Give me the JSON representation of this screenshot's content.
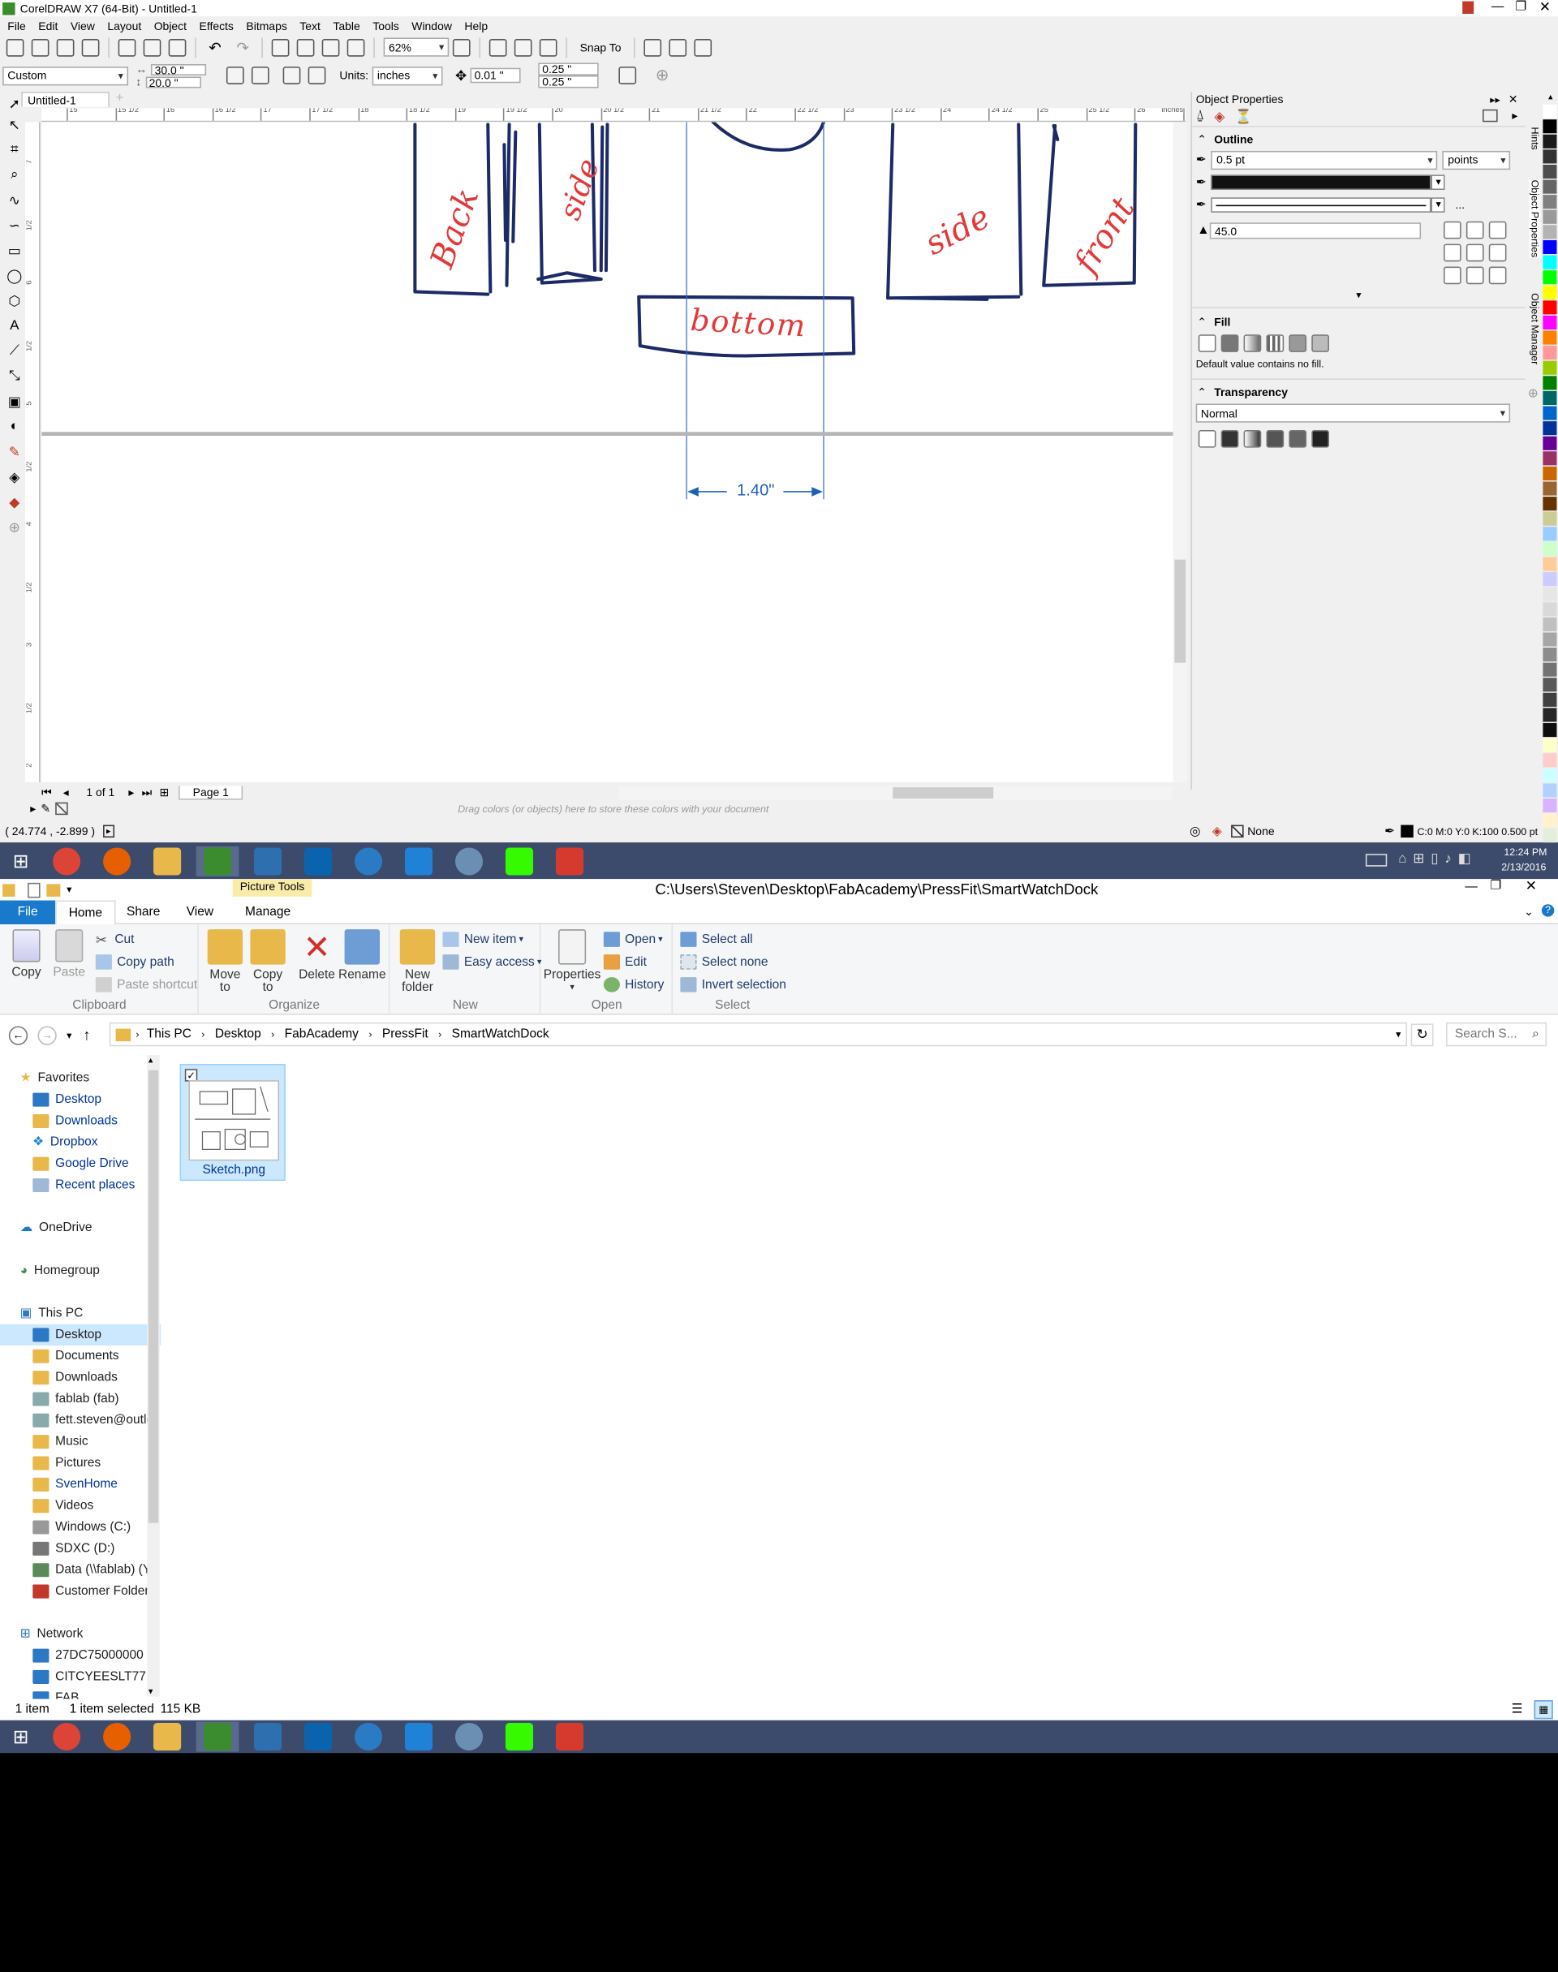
{
  "corel": {
    "title": "CorelDRAW X7 (64-Bit) - Untitled-1",
    "menu": [
      "File",
      "Edit",
      "View",
      "Layout",
      "Object",
      "Effects",
      "Bitmaps",
      "Text",
      "Table",
      "Tools",
      "Window",
      "Help"
    ],
    "zoom": "62%",
    "snap_to": "Snap To",
    "page_size": "Custom",
    "width": "30.0 \"",
    "height": "20.0 \"",
    "units_label": "Units:",
    "units": "inches",
    "nudge": "0.01 \"",
    "dup_x": "0.25 \"",
    "dup_y": "0.25 \"",
    "doc_tab": "Untitled-1",
    "ruler_ticks": [
      "15",
      "15 1/2",
      "16",
      "16 1/2",
      "17",
      "17 1/2",
      "18",
      "18 1/2",
      "19",
      "19 1/2",
      "20",
      "20 1/2",
      "21",
      "21 1/2",
      "22",
      "22 1/2",
      "23",
      "23 1/2",
      "24",
      "24 1/2",
      "25",
      "25 1/2",
      "26",
      "26 1/2"
    ],
    "ruler_unit": "inches",
    "vruler_ticks": [
      "7",
      "1/2",
      "6",
      "1/2",
      "5",
      "1/2",
      "4",
      "1/2",
      "3",
      "1/2",
      "2"
    ],
    "sketch_labels": {
      "back": "Back",
      "side_left": "side",
      "side_right": "side",
      "front": "front",
      "bottom": "bottom"
    },
    "dimension": "1.40\"",
    "page_nav": "1 of 1",
    "page_tab": "Page 1",
    "color_hint": "Drag colors (or objects) here to store these colors with your document",
    "status_coords": "( 24.774 , -2.899 )",
    "status_fill": "None",
    "status_outline": "C:0 M:0 Y:0 K:100  0.500 pt",
    "docker": {
      "title": "Object Properties",
      "outline_head": "Outline",
      "outline_width": "0.5 pt",
      "outline_units": "points",
      "miter": "45.0",
      "more": "...",
      "fill_head": "Fill",
      "fill_note": "Default value contains no fill.",
      "transparency_head": "Transparency",
      "transparency_mode": "Normal"
    },
    "side_tabs": [
      "Hints",
      "Object Properties",
      "Object Manager"
    ],
    "palette": [
      "#ffffff",
      "#000000",
      "#1a1a1a",
      "#333333",
      "#4d4d4d",
      "#666666",
      "#808080",
      "#999999",
      "#b3b3b3",
      "#0000ff",
      "#00ffff",
      "#00ff00",
      "#ffff00",
      "#ff0000",
      "#ff00ff",
      "#ff8000",
      "#ff9999",
      "#99cc00",
      "#008000",
      "#006666",
      "#0066cc",
      "#003399",
      "#660099",
      "#993366",
      "#cc6600",
      "#996633",
      "#663300",
      "#cccc99",
      "#99ccff",
      "#ccffcc",
      "#ffcc99",
      "#ccccff",
      "#e6e6e6",
      "#d9d9d9",
      "#c0c0c0",
      "#a6a6a6",
      "#8c8c8c",
      "#737373",
      "#595959",
      "#404040",
      "#262626",
      "#0d0d0d",
      "#ffffcc",
      "#ffcccc",
      "#ccffff",
      "#b2d1ff",
      "#d9b3ff",
      "#fff2cc",
      "#e2efda",
      "#dde6f5"
    ]
  },
  "taskbar": {
    "time": "12:24 PM",
    "date": "2/13/2016",
    "apps": [
      {
        "name": "chrome",
        "color": "#db4437"
      },
      {
        "name": "firefox",
        "color": "#e66000"
      },
      {
        "name": "explorer",
        "color": "#e8b84a"
      },
      {
        "name": "coreldraw",
        "color": "#3a8c2e"
      },
      {
        "name": "network-tool",
        "color": "#2e6fb0"
      },
      {
        "name": "outlook",
        "color": "#0a64ad"
      },
      {
        "name": "remote",
        "color": "#2b7bc4"
      },
      {
        "name": "dropbox",
        "color": "#1f82d6"
      },
      {
        "name": "clock",
        "color": "#6b8fb3"
      },
      {
        "name": "dreamweaver",
        "color": "#35fa00"
      },
      {
        "name": "sketchup",
        "color": "#d63a2f"
      }
    ]
  },
  "explorer": {
    "context_tab": "Picture Tools",
    "path_title": "C:\\Users\\Steven\\Desktop\\FabAcademy\\PressFit\\SmartWatchDock",
    "tabs": [
      "File",
      "Home",
      "Share",
      "View",
      "Manage"
    ],
    "clipboard": {
      "copy": "Copy",
      "paste": "Paste",
      "cut": "Cut",
      "copy_path": "Copy path",
      "paste_shortcut": "Paste shortcut",
      "label": "Clipboard"
    },
    "organize": {
      "move": "Move",
      "move2": "to",
      "copy": "Copy",
      "copy2": "to",
      "delete": "Delete",
      "rename": "Rename",
      "label": "Organize"
    },
    "new": {
      "folder": "New",
      "folder2": "folder",
      "item": "New item",
      "easy": "Easy access",
      "label": "New"
    },
    "open": {
      "properties": "Properties",
      "open": "Open",
      "edit": "Edit",
      "history": "History",
      "label": "Open"
    },
    "select": {
      "all": "Select all",
      "none": "Select none",
      "invert": "Invert selection",
      "label": "Select"
    },
    "breadcrumb": [
      "This PC",
      "Desktop",
      "FabAcademy",
      "PressFit",
      "SmartWatchDock"
    ],
    "search_placeholder": "Search S...",
    "nav": {
      "favorites": "Favorites",
      "fav_items": [
        "Desktop",
        "Downloads",
        "Dropbox",
        "Google Drive",
        "Recent places"
      ],
      "onedrive": "OneDrive",
      "homegroup": "Homegroup",
      "thispc": "This PC",
      "pc_items": [
        "Desktop",
        "Documents",
        "Downloads",
        "fablab (fab)",
        "fett.steven@outlc",
        "Music",
        "Pictures",
        "SvenHome",
        "Videos",
        "Windows (C:)",
        "SDXC (D:)",
        "Data (\\\\fablab) (Y",
        "Customer Folder"
      ],
      "network": "Network",
      "net_items": [
        "27DC75000000",
        "CITCYEESLT77",
        "FAB"
      ]
    },
    "file": {
      "name": "Sketch.png"
    },
    "status": {
      "count": "1 item",
      "selected": "1 item selected",
      "size": "115 KB"
    }
  }
}
